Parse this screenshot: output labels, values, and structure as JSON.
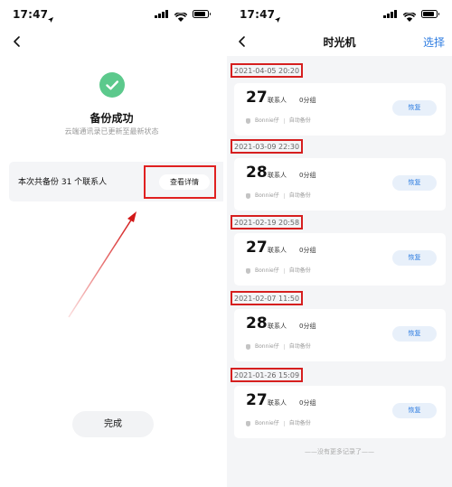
{
  "left_screen": {
    "status_time": "17:47",
    "title": "备份成功",
    "subtitle": "云端通讯录已更新至最新状态",
    "summary": "本次共备份 31 个联系人",
    "details_button": "查看详情",
    "done_button": "完成"
  },
  "right_screen": {
    "status_time": "17:47",
    "title": "时光机",
    "select_button": "选择",
    "backups": [
      {
        "date": "2021-04-05 20:20",
        "count": "27",
        "count_unit": "联系人",
        "groups": "0分组",
        "device": "Bonnie仔",
        "mode": "自动备份",
        "restore": "恢复"
      },
      {
        "date": "2021-03-09 22:30",
        "count": "28",
        "count_unit": "联系人",
        "groups": "0分组",
        "device": "Bonnie仔",
        "mode": "自动备份",
        "restore": "恢复"
      },
      {
        "date": "2021-02-19 20:58",
        "count": "27",
        "count_unit": "联系人",
        "groups": "0分组",
        "device": "Bonnie仔",
        "mode": "自动备份",
        "restore": "恢复"
      },
      {
        "date": "2021-02-07 11:50",
        "count": "28",
        "count_unit": "联系人",
        "groups": "0分组",
        "device": "Bonnie仔",
        "mode": "自动备份",
        "restore": "恢复"
      },
      {
        "date": "2021-01-26 15:09",
        "count": "27",
        "count_unit": "联系人",
        "groups": "0分组",
        "device": "Bonnie仔",
        "mode": "自动备份",
        "restore": "恢复"
      }
    ],
    "footer": "——没有更多记录了——"
  },
  "colors": {
    "success_green": "#5cc98c",
    "accent_blue": "#2f7de1",
    "annotation_red": "#e02020"
  }
}
